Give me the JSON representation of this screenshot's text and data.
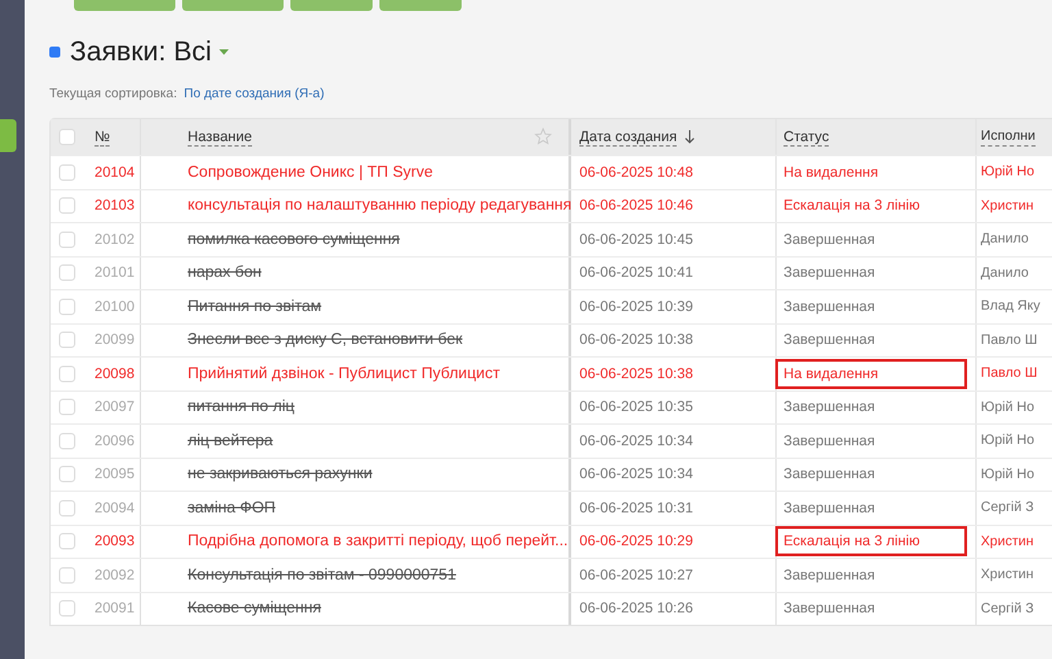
{
  "page_title": {
    "text": "Заявки: Всі",
    "color": "#2f7bf5"
  },
  "sorting": {
    "label": "Текущая сортировка:",
    "value": "По дате создания (Я-а)"
  },
  "table": {
    "select_all_checked": false,
    "columns": [
      {
        "label": "№"
      },
      {
        "label": "Название"
      },
      {
        "label": "Дата создания",
        "sorted": true
      },
      {
        "label": "Статус"
      },
      {
        "label": "Исполни"
      }
    ],
    "rows": [
      {
        "kind": "active",
        "number": "20104",
        "title": "Сопровождение Оникс | ТП Syrve",
        "date": "06-06-2025 10:48",
        "status": "На видалення",
        "assignee": "Юрій Но",
        "highlighted": false,
        "checked": false
      },
      {
        "kind": "active",
        "number": "20103",
        "title": "консультація по налаштуванню періоду редагування",
        "date": "06-06-2025 10:46",
        "status": "Ескалація на 3 лінію",
        "assignee": "Христин",
        "highlighted": false,
        "checked": false
      },
      {
        "kind": "done",
        "number": "20102",
        "title": "помилка касового суміщення",
        "date": "06-06-2025 10:45",
        "status": "Завершенная",
        "assignee": "Данило",
        "highlighted": false,
        "checked": false
      },
      {
        "kind": "done",
        "number": "20101",
        "title": "нарах бон",
        "date": "06-06-2025 10:41",
        "status": "Завершенная",
        "assignee": "Данило",
        "highlighted": false,
        "checked": false
      },
      {
        "kind": "done",
        "number": "20100",
        "title": "Питання по звітам",
        "date": "06-06-2025 10:39",
        "status": "Завершенная",
        "assignee": "Влад Яку",
        "highlighted": false,
        "checked": false
      },
      {
        "kind": "done",
        "number": "20099",
        "title": "Знесли все з диску С, встановити бек",
        "date": "06-06-2025 10:38",
        "status": "Завершенная",
        "assignee": "Павло Ш",
        "highlighted": false,
        "checked": false
      },
      {
        "kind": "active",
        "number": "20098",
        "title": "Прийнятий дзвінок - Публицист Публицист",
        "date": "06-06-2025 10:38",
        "status": "На видалення",
        "assignee": "Павло Ш",
        "highlighted": true,
        "checked": false
      },
      {
        "kind": "done",
        "number": "20097",
        "title": "питання по ліц",
        "date": "06-06-2025 10:35",
        "status": "Завершенная",
        "assignee": "Юрій Но",
        "highlighted": false,
        "checked": false
      },
      {
        "kind": "done",
        "number": "20096",
        "title": "ліц вейтера",
        "date": "06-06-2025 10:34",
        "status": "Завершенная",
        "assignee": "Юрій Но",
        "highlighted": false,
        "checked": false
      },
      {
        "kind": "done",
        "number": "20095",
        "title": "не закриваються рахунки",
        "date": "06-06-2025 10:34",
        "status": "Завершенная",
        "assignee": "Юрій Но",
        "highlighted": false,
        "checked": false
      },
      {
        "kind": "done",
        "number": "20094",
        "title": "заміна ФОП",
        "date": "06-06-2025 10:31",
        "status": "Завершенная",
        "assignee": "Сергій З",
        "highlighted": false,
        "checked": false
      },
      {
        "kind": "active",
        "number": "20093",
        "title": "Подрібна допомога в закритті періоду, щоб перейт...",
        "date": "06-06-2025 10:29",
        "status": "Ескалація на 3 лінію",
        "assignee": "Христин",
        "highlighted": true,
        "checked": false
      },
      {
        "kind": "done",
        "number": "20092",
        "title": "Консультація по звітам - 0990000751",
        "date": "06-06-2025 10:27",
        "status": "Завершенная",
        "assignee": "Христин",
        "highlighted": false,
        "checked": false
      },
      {
        "kind": "done",
        "number": "20091",
        "title": "Касове суміщення",
        "date": "06-06-2025 10:26",
        "status": "Завершенная",
        "assignee": "Сергій З",
        "highlighted": false,
        "checked": false
      }
    ]
  }
}
